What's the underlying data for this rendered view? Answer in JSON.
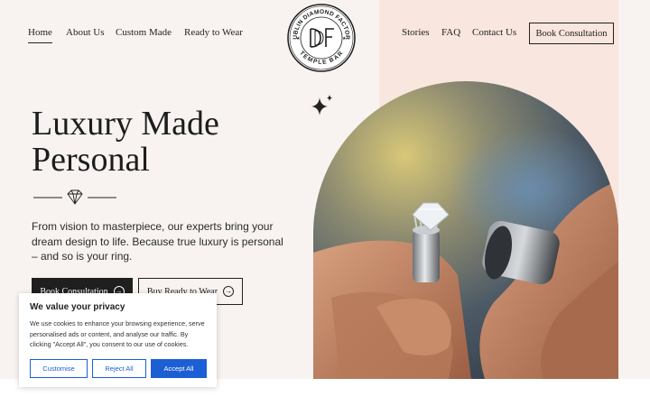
{
  "nav": {
    "left": [
      "Home",
      "About Us",
      "Custom Made",
      "Ready to Wear"
    ],
    "right": [
      "Stories",
      "FAQ",
      "Contact Us"
    ],
    "cta": "Book Consultation"
  },
  "logo": {
    "top_text": "DUBLIN DIAMOND FACTORY",
    "bottom_text": "TEMPLE BAR",
    "monogram": "DDF"
  },
  "hero": {
    "title_line1": "Luxury Made",
    "title_line2": "Personal",
    "description": "From vision to masterpiece, our experts bring your dream design to life. Because true luxury is personal – and so is your ring.",
    "primary_button": "Book Consultation",
    "secondary_button": "Buy Ready to Wear"
  },
  "cookie": {
    "title": "We value your privacy",
    "text": "We use cookies to enhance your browsing experience, serve personalised ads or content, and analyse our traffic. By clicking \"Accept All\", you consent to our use of cookies.",
    "customise": "Customise",
    "reject": "Reject All",
    "accept": "Accept All"
  },
  "icons": {
    "divider": "diamond-icon",
    "sparkle": "sparkle-icon",
    "button_arrow": "arrow-right-circle-icon"
  },
  "colors": {
    "background": "#f8f3f0",
    "panel": "#f8e6df",
    "dark": "#1f1f1f",
    "cookie_accent": "#1c5fd4"
  }
}
